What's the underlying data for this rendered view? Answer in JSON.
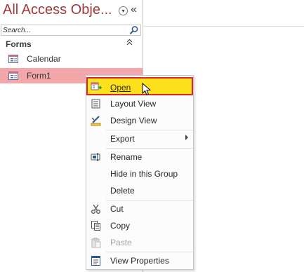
{
  "nav": {
    "title": "All Access Obje...",
    "menu_glyph": "▾",
    "collapse_glyph": "«",
    "search": {
      "placeholder": "Search...",
      "value": ""
    },
    "group": {
      "label": "Forms",
      "chevron": "⌃"
    },
    "items": [
      {
        "label": "Calendar",
        "icon": "form-icon",
        "selected": false
      },
      {
        "label": "Form1",
        "icon": "form-icon",
        "selected": true
      }
    ]
  },
  "colors": {
    "title": "#a4373a",
    "selected_row": "#f4a7ab",
    "menu_highlight": "#fde21b",
    "menu_highlight_border": "#d9262c"
  },
  "context_menu": {
    "items": [
      {
        "label": "Open",
        "icon": "open-form-icon",
        "accel": "O"
      },
      {
        "label": "Layout View",
        "icon": "layout-view-icon",
        "accel": "L"
      },
      {
        "label": "Design View",
        "icon": "design-view-icon",
        "accel": "D"
      },
      {
        "label": "Export",
        "icon": "",
        "accel": "E",
        "submenu": true
      },
      {
        "label": "Rename",
        "icon": "rename-icon",
        "accel": "m"
      },
      {
        "label": "Hide in this Group",
        "icon": "",
        "accel": "H"
      },
      {
        "label": "Delete",
        "icon": "",
        "accel": "l"
      },
      {
        "label": "Cut",
        "icon": "scissors-icon",
        "accel": "t"
      },
      {
        "label": "Copy",
        "icon": "copy-icon",
        "accel": "C"
      },
      {
        "label": "Paste",
        "icon": "paste-icon",
        "accel": "P",
        "disabled": true
      },
      {
        "label": "View Properties",
        "icon": "properties-icon",
        "accel": "r"
      }
    ]
  }
}
